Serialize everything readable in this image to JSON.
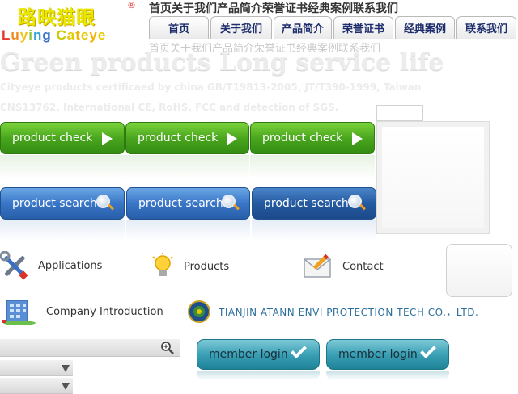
{
  "logo": {
    "cn": "路映猫眼",
    "reg_mark": "®",
    "en_letters": [
      {
        "ch": "L",
        "color": "#e33b2e"
      },
      {
        "ch": "u",
        "color": "#f08a1c"
      },
      {
        "ch": "y",
        "color": "#f2c21a"
      },
      {
        "ch": "i",
        "color": "#8cc63f"
      },
      {
        "ch": "n",
        "color": "#33a5dd"
      },
      {
        "ch": "g",
        "color": "#3a6fc9"
      },
      {
        "ch": " ",
        "color": "#ffffff"
      },
      {
        "ch": "C",
        "color": "#c9c900"
      },
      {
        "ch": "a",
        "color": "#e3c800"
      },
      {
        "ch": "t",
        "color": "#f0b400"
      },
      {
        "ch": "e",
        "color": "#e3c800"
      },
      {
        "ch": "y",
        "color": "#f0b400"
      },
      {
        "ch": "e",
        "color": "#e3c800"
      }
    ]
  },
  "top_links_text": "首页关于我们产品简介荣誉证书经典案例联系我们",
  "top_links_shadow_text": "首页关于我们产品简介荣誉证书经典案例联系我们",
  "nav": {
    "tabs": [
      {
        "label": "首页"
      },
      {
        "label": "关于我们"
      },
      {
        "label": "产品简介"
      },
      {
        "label": "荣誉证书"
      },
      {
        "label": "经典案例"
      },
      {
        "label": "联系我们"
      }
    ]
  },
  "hero": {
    "headline": "Green products   Long service life",
    "cert_line_1": "Cityeye products certificaed by china  GB/T19813-2005, JT/T390-1999,  Taiwan",
    "cert_line_2": "CNS13762,  International CE, RoHS, FCC and detection of SGS."
  },
  "buttons": {
    "product_check": [
      "product check",
      "product check",
      "product check"
    ],
    "product_search": [
      "product search",
      "product search",
      "product search"
    ]
  },
  "links": {
    "applications": "Applications",
    "products": "Products",
    "contact": "Contact",
    "company_introduction": "Company Introduction"
  },
  "company_name": "TIANJIN ATANN ENVI PROTECTION TECH CO.，LTD.",
  "member_login": [
    "member login",
    "member login"
  ],
  "colors": {
    "green_button": "#4aa61e",
    "blue_button": "#3a76c8",
    "teal_button": "#3aa0b5",
    "company_text": "#2a6f9e"
  }
}
